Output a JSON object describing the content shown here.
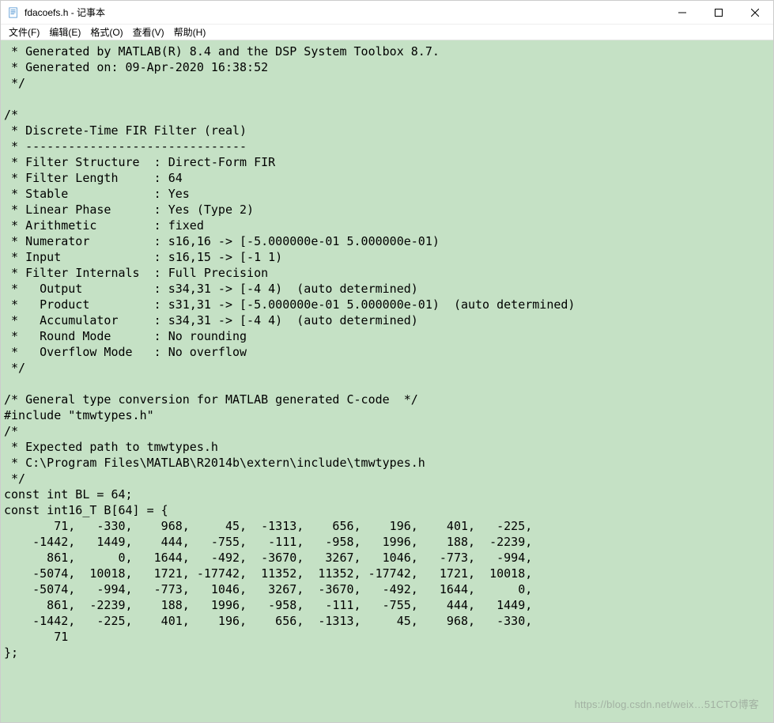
{
  "window": {
    "title": "fdacoefs.h - 记事本"
  },
  "menu": {
    "file": "文件(F)",
    "edit": "编辑(E)",
    "format": "格式(O)",
    "view": "查看(V)",
    "help": "帮助(H)"
  },
  "content": {
    "text": " * Generated by MATLAB(R) 8.4 and the DSP System Toolbox 8.7.\n * Generated on: 09-Apr-2020 16:38:52\n */\n\n/*\n * Discrete-Time FIR Filter (real)\n * -------------------------------\n * Filter Structure  : Direct-Form FIR\n * Filter Length     : 64\n * Stable            : Yes\n * Linear Phase      : Yes (Type 2)\n * Arithmetic        : fixed\n * Numerator         : s16,16 -> [-5.000000e-01 5.000000e-01)\n * Input             : s16,15 -> [-1 1)\n * Filter Internals  : Full Precision\n *   Output          : s34,31 -> [-4 4)  (auto determined)\n *   Product         : s31,31 -> [-5.000000e-01 5.000000e-01)  (auto determined)\n *   Accumulator     : s34,31 -> [-4 4)  (auto determined)\n *   Round Mode      : No rounding\n *   Overflow Mode   : No overflow\n */\n\n/* General type conversion for MATLAB generated C-code  */\n#include \"tmwtypes.h\"\n/*\n * Expected path to tmwtypes.h\n * C:\\Program Files\\MATLAB\\R2014b\\extern\\include\\tmwtypes.h\n */\nconst int BL = 64;\nconst int16_T B[64] = {\n       71,   -330,    968,     45,  -1313,    656,    196,    401,   -225,\n    -1442,   1449,    444,   -755,   -111,   -958,   1996,    188,  -2239,\n      861,      0,   1644,   -492,  -3670,   3267,   1046,   -773,   -994,\n    -5074,  10018,   1721, -17742,  11352,  11352, -17742,   1721,  10018,\n    -5074,   -994,   -773,   1046,   3267,  -3670,   -492,   1644,      0,\n      861,  -2239,    188,   1996,   -958,   -111,   -755,    444,   1449,\n    -1442,   -225,    401,    196,    656,  -1313,     45,    968,   -330,\n       71\n};"
  },
  "watermark": "https://blog.csdn.net/weix…51CTO博客"
}
